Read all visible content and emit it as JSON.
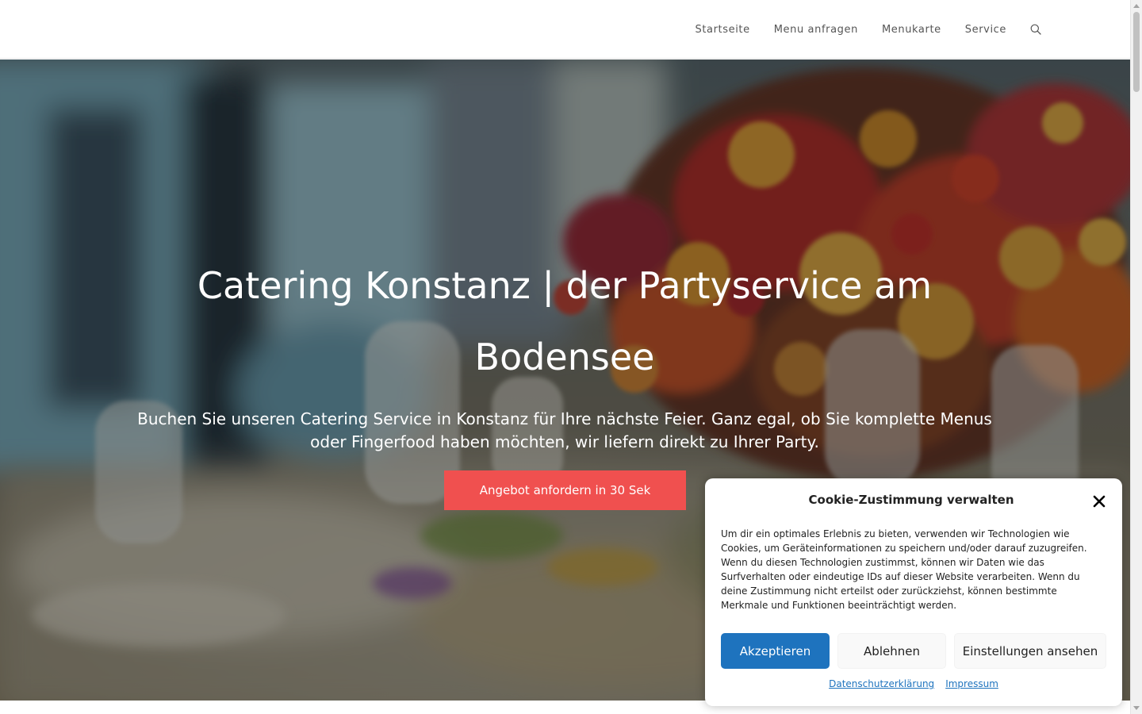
{
  "header": {
    "nav": [
      {
        "label": "Startseite"
      },
      {
        "label": "Menu anfragen"
      },
      {
        "label": "Menukarte"
      },
      {
        "label": "Service"
      }
    ],
    "search_icon": "search-icon"
  },
  "hero": {
    "title": "Catering Konstanz | der Partyservice am Bodensee",
    "text": "Buchen Sie unseren Catering Service in Konstanz für Ihre nächste Feier. Ganz egal, ob Sie komplette Menus oder Fingerfood haben möchten, wir liefern direkt zu Ihrer Party.",
    "button_label": "Angebot anfordern in 30 Sek",
    "button_color": "#f0504f"
  },
  "cookie": {
    "title": "Cookie-Zustimmung verwalten",
    "text": "Um dir ein optimales Erlebnis zu bieten, verwenden wir Technologien wie Cookies, um Geräteinformationen zu speichern und/oder darauf zuzugreifen. Wenn du diesen Technologien zustimmst, können wir Daten wie das Surfverhalten oder eindeutige IDs auf dieser Website verarbeiten. Wenn du deine Zustimmung nicht erteilst oder zurückziehst, können bestimmte Merkmale und Funktionen beeinträchtigt werden.",
    "accept_label": "Akzeptieren",
    "deny_label": "Ablehnen",
    "settings_label": "Einstellungen ansehen",
    "privacy_link": "Datenschutzerklärung",
    "imprint_link": "Impressum",
    "accent_color": "#1e73be"
  }
}
